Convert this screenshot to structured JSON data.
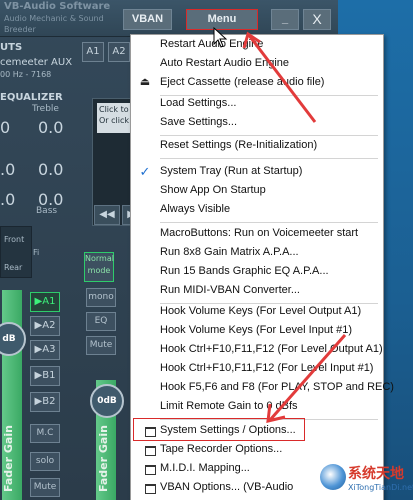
{
  "window": {
    "brand_line1": "VB-Audio Software",
    "brand_line2": "Audio Mechanic & Sound Breeder",
    "vban_label": "VBAN",
    "menu_label": "Menu",
    "minimize_label": "_",
    "close_label": "X"
  },
  "strip": {
    "section_inputs": "UTS",
    "device_name": "cemeeter AUX",
    "device_info": "00 Hz - 7168",
    "section_equalizer": "EQUALIZER",
    "treble_label": "Treble",
    "treble_value": "0.0",
    "mid_value": "0.0",
    "bass_value": "0.0",
    "bass_label": "Bass",
    "left_knob_value_top": "0",
    "left_knob_value_mid": ".0",
    "left_knob_value_bot": ".0",
    "front_label": "Front",
    "rear_label": "Rear",
    "fi_label": "Fi",
    "bus_a1": "A1",
    "bus_a2": "A2",
    "bus_a1_side": "▶A1",
    "bus_a2_side": "▶A2",
    "bus_a3_side": "▶A3",
    "bus_b1_side": "▶B1",
    "bus_b2_side": "▶B2",
    "normal_mode": "Normal mode",
    "mono_label": "mono",
    "eq_label": "EQ",
    "mute_label": "Mute",
    "mc_label": "M.C",
    "solo_label": "solo",
    "mute2_label": "Mute",
    "fader_gain_label": "Fader Gain",
    "fader_gain_label2": "Fader Gain",
    "db_label_left": "dB",
    "db_label_mid": "0dB",
    "tape_click_line1": "Click to S",
    "tape_click_line2": "Or click o"
  },
  "context_menu": {
    "items": [
      {
        "label": "Restart Audio Engine"
      },
      {
        "label": "Auto Restart Audio Engine"
      },
      {
        "label": "Eject Cassette (release audio file)"
      },
      {
        "label": "Load Settings..."
      },
      {
        "label": "Save Settings..."
      },
      {
        "label": "Reset Settings (Re-Initialization)"
      },
      {
        "label": "System Tray (Run at Startup)"
      },
      {
        "label": "Show App On Startup"
      },
      {
        "label": "Always Visible"
      },
      {
        "label": "MacroButtons: Run on Voicemeeter start"
      },
      {
        "label": "Run 8x8 Gain Matrix A.P.A..."
      },
      {
        "label": "Run 15 Bands Graphic EQ A.P.A..."
      },
      {
        "label": "Run MIDI-VBAN Converter..."
      },
      {
        "label": "Hook Volume Keys (For Level Output A1)"
      },
      {
        "label": "Hook Volume Keys (For Level Input #1)"
      },
      {
        "label": "Hook Ctrl+F10,F11,F12 (For Level Output A1)"
      },
      {
        "label": "Hook Ctrl+F10,F11,F12 (For Level Input #1)"
      },
      {
        "label": "Hook F5,F6 and F8 (For PLAY, STOP and REC)"
      },
      {
        "label": "Limit Remote Gain to 0 dBfs"
      },
      {
        "label": "System Settings / Options..."
      },
      {
        "label": "Tape Recorder Options..."
      },
      {
        "label": "M.I.D.I. Mapping..."
      },
      {
        "label": "VBAN Options... (VB-Audio"
      }
    ],
    "checked_item": "System Tray (Run at Startup)",
    "eject_icon": "eject-icon",
    "window_icon": "window-icon"
  },
  "watermark": {
    "title": "系统天地",
    "subtitle": "XiTongTianDi.net"
  },
  "colors": {
    "highlight": "#d92a2a",
    "active_bus": "#3cf07a",
    "fader_green": "#4fbf78",
    "check_blue": "#1e6fd0"
  }
}
